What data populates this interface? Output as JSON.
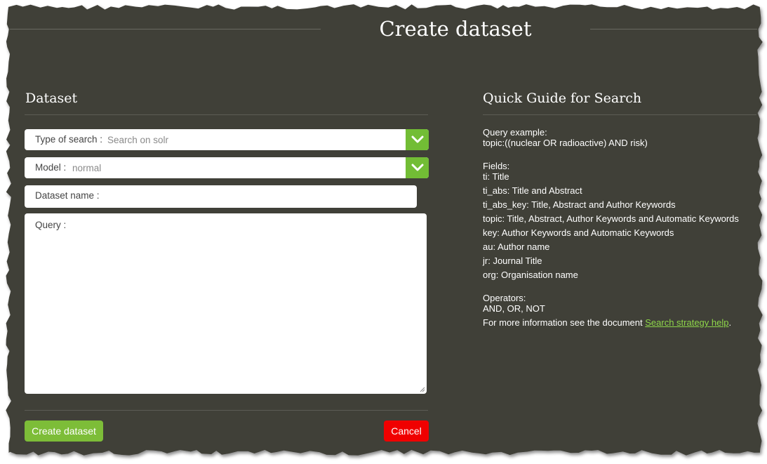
{
  "page": {
    "title": "Create dataset"
  },
  "colors": {
    "panel_background": "#403f39",
    "accent_green": "#72bd35",
    "button_green": "#7dbd38",
    "cancel_red": "#f00000",
    "link_green": "#8ed64a"
  },
  "form": {
    "section_title": "Dataset",
    "type_of_search": {
      "label": "Type of search :",
      "value": "Search on solr",
      "icon": "chevron-down-icon"
    },
    "model": {
      "label": "Model :",
      "value": "normal",
      "icon": "chevron-down-icon"
    },
    "dataset_name": {
      "label": "Dataset name :",
      "value": ""
    },
    "query": {
      "label": "Query :",
      "value": ""
    },
    "create_label": "Create dataset",
    "cancel_label": "Cancel"
  },
  "guide": {
    "section_title": "Quick Guide for Search",
    "example_heading": "Query example:",
    "example_query": "topic:((nuclear OR radioactive) AND risk)",
    "fields_heading": "Fields:",
    "fields": [
      "ti: Title",
      "ti_abs: Title and Abstract",
      "ti_abs_key: Title, Abstract and Author Keywords",
      "topic: Title, Abstract, Author Keywords and Automatic Keywords",
      "key: Author Keywords and Automatic Keywords",
      "au: Author name",
      "jr: Journal Title",
      "org: Organisation name"
    ],
    "operators_heading": "Operators:",
    "operators": "AND, OR, NOT",
    "more_info_text": "For more information see the document ",
    "more_info_link": "Search strategy help",
    "more_info_suffix": "."
  }
}
